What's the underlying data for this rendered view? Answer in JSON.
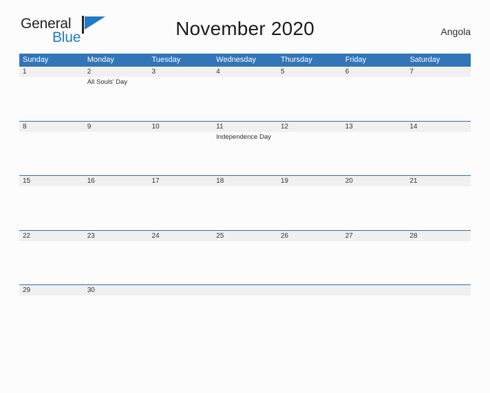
{
  "brand": {
    "name_part1": "General",
    "name_part2": "Blue",
    "flag_icon": "flag-triangle-icon",
    "accent_color": "#1f7ac4"
  },
  "header": {
    "title": "November 2020",
    "country": "Angola"
  },
  "theme": {
    "header_blue": "#3275b8",
    "row_rule_blue": "#2e6da4",
    "day_band_gray": "#f0f0f0",
    "page_background": "#fcfcfc"
  },
  "calendar": {
    "month": "November",
    "year": "2020",
    "weekday_headers": [
      "Sunday",
      "Monday",
      "Tuesday",
      "Wednesday",
      "Thursday",
      "Friday",
      "Saturday"
    ],
    "weeks": [
      {
        "days": [
          {
            "date": "1",
            "event": ""
          },
          {
            "date": "2",
            "event": "All Souls' Day"
          },
          {
            "date": "3",
            "event": ""
          },
          {
            "date": "4",
            "event": ""
          },
          {
            "date": "5",
            "event": ""
          },
          {
            "date": "6",
            "event": ""
          },
          {
            "date": "7",
            "event": ""
          }
        ]
      },
      {
        "days": [
          {
            "date": "8",
            "event": ""
          },
          {
            "date": "9",
            "event": ""
          },
          {
            "date": "10",
            "event": ""
          },
          {
            "date": "11",
            "event": "Independence Day"
          },
          {
            "date": "12",
            "event": ""
          },
          {
            "date": "13",
            "event": ""
          },
          {
            "date": "14",
            "event": ""
          }
        ]
      },
      {
        "days": [
          {
            "date": "15",
            "event": ""
          },
          {
            "date": "16",
            "event": ""
          },
          {
            "date": "17",
            "event": ""
          },
          {
            "date": "18",
            "event": ""
          },
          {
            "date": "19",
            "event": ""
          },
          {
            "date": "20",
            "event": ""
          },
          {
            "date": "21",
            "event": ""
          }
        ]
      },
      {
        "days": [
          {
            "date": "22",
            "event": ""
          },
          {
            "date": "23",
            "event": ""
          },
          {
            "date": "24",
            "event": ""
          },
          {
            "date": "25",
            "event": ""
          },
          {
            "date": "26",
            "event": ""
          },
          {
            "date": "27",
            "event": ""
          },
          {
            "date": "28",
            "event": ""
          }
        ]
      },
      {
        "days": [
          {
            "date": "29",
            "event": ""
          },
          {
            "date": "30",
            "event": ""
          },
          {
            "date": "",
            "event": ""
          },
          {
            "date": "",
            "event": ""
          },
          {
            "date": "",
            "event": ""
          },
          {
            "date": "",
            "event": ""
          },
          {
            "date": "",
            "event": ""
          }
        ]
      }
    ]
  }
}
